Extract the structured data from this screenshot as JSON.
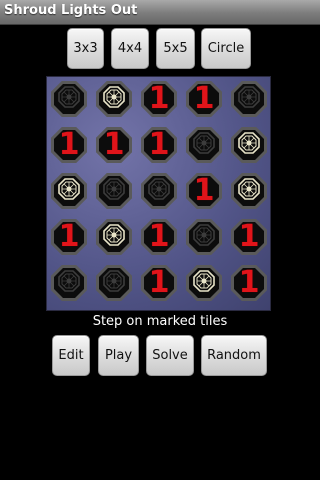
{
  "title": "Shroud Lights Out",
  "size_buttons": [
    {
      "label": "3x3"
    },
    {
      "label": "4x4"
    },
    {
      "label": "5x5"
    },
    {
      "label": "Circle"
    }
  ],
  "board": {
    "rows": 5,
    "cols": 5,
    "mark_glyph": "1",
    "legend": {
      "M": "marked tile (red 1)",
      "L": "lit shroud tile",
      "D": "dark tile"
    },
    "cells": [
      [
        "D",
        "L",
        "M",
        "M",
        "D"
      ],
      [
        "M",
        "M",
        "M",
        "D",
        "L"
      ],
      [
        "L",
        "D",
        "D",
        "M",
        "L"
      ],
      [
        "M",
        "L",
        "M",
        "D",
        "M"
      ],
      [
        "D",
        "D",
        "M",
        "L",
        "M"
      ]
    ]
  },
  "status": "Step on marked tiles",
  "action_buttons": [
    {
      "label": "Edit"
    },
    {
      "label": "Play"
    },
    {
      "label": "Solve"
    },
    {
      "label": "Random"
    }
  ],
  "colors": {
    "mark": "#e0141a",
    "board_bg": "#515487",
    "shroud_lit": "#e8e4c8",
    "shroud_dark": "#3c3c3c"
  }
}
